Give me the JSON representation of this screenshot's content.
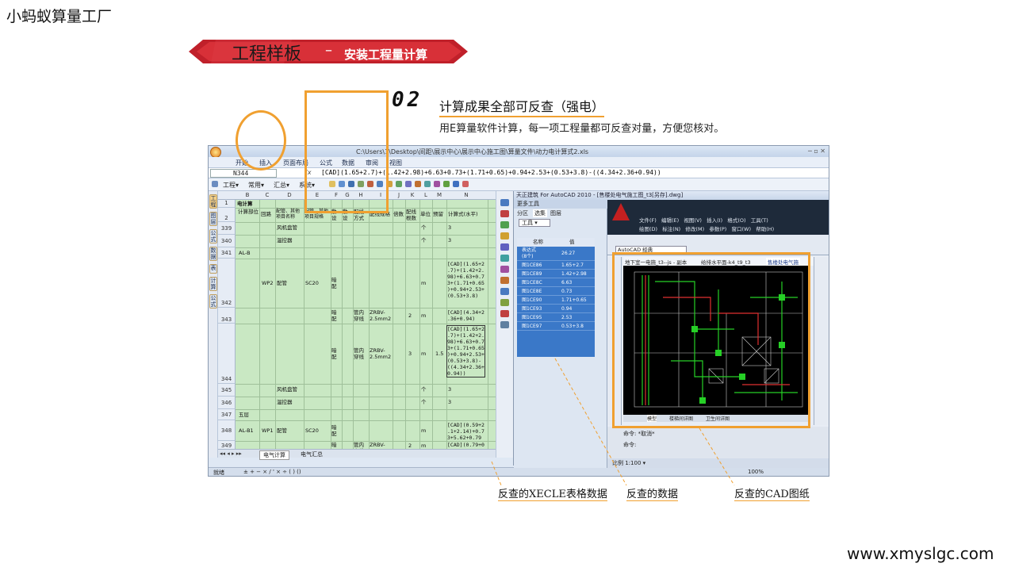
{
  "brand": "小蚂蚁算量工厂",
  "banner": {
    "title": "工程样板",
    "dash": "–",
    "subtitle": "安装工程量计算"
  },
  "section": {
    "number": "02",
    "title": "计算成果全部可反查（强电）",
    "description": "用E算量软件计算，每一项工程量都可反查对量，方便您核对。"
  },
  "website": "www.xmyslgc.com",
  "excel": {
    "window_title": "C:\\Users\\1\\Desktop\\间距\\展示中心\\展示中心施工图\\算量文件\\动力电计算式2.xls",
    "window_buttons": "─ ▫ ✕",
    "ribbon_tabs": [
      "开始",
      "插入",
      "页面布局",
      "公式",
      "数据",
      "审阅",
      "视图"
    ],
    "name_box": "N344",
    "fx": "fx",
    "formula": "[CAD](1.65+2.7)+(1.42+2.98)+6.63+0.73+(1.71+0.65)+0.94+2.53+(0.53+3.8)-((4.34+2.36+0.94))",
    "toolbar": [
      "工程▾",
      "常用▾",
      "汇总▾",
      "系统▾"
    ],
    "side_tabs": [
      "工程",
      "图层",
      "公式",
      "数据",
      "表",
      "计算",
      "公式"
    ],
    "columns": [
      "B",
      "C",
      "D",
      "E",
      "F",
      "G",
      "H",
      "I",
      "J",
      "K",
      "L",
      "M",
      "N"
    ],
    "header_row": {
      "row": "2",
      "cells": [
        "计算部位",
        "回路",
        "配管、其他项目名称",
        "配管、其他项目规格",
        "敷设",
        "敷设",
        "配线方式",
        "配线规格",
        "倍数",
        "配线根数",
        "单位",
        "预留",
        "计算式(水平)"
      ]
    },
    "title_row": {
      "row": "1",
      "text": "电计算"
    },
    "rows": [
      {
        "row": "339",
        "name": "风机盘管",
        "unit": "个",
        "value": "3"
      },
      {
        "row": "340",
        "name": "温控器",
        "unit": "个",
        "value": "3"
      },
      {
        "row": "341",
        "part": "AL-B"
      },
      {
        "row": "342",
        "circuit": "WP2",
        "name": "配管",
        "spec": "SC20",
        "lay": "暗配",
        "unit": "m",
        "formula": "[CAD](1.65+2\n.7)+(1.42+2.\n98)+6.63+0.7\n3+(1.71+0.65\n)+0.94+2.53+\n(0.53+3.8)"
      },
      {
        "row": "343",
        "lay": "暗配",
        "method": "管内穿线",
        "wire": "ZRBV-2.5mm2",
        "count": "2",
        "unit": "m",
        "formula": "[CAD](4.34+2\n.36+0.94)"
      },
      {
        "row": "344",
        "lay": "暗配",
        "method": "管内穿线",
        "wire": "ZRBV-2.5mm2",
        "count": "3",
        "unit": "m",
        "reserve": "1.5",
        "formula": "[CAD](1.65+2\n.7)+(1.42+2.\n98)+6.63+0.7\n3+(1.71+0.65\n)+0.94+2.53+\n(0.53+3.8)-\n((4.34+2.36+\n0.94))"
      },
      {
        "row": "345",
        "name": "风机盘管",
        "unit": "个",
        "value": "3"
      },
      {
        "row": "346",
        "name": "温控器",
        "unit": "个",
        "value": "3"
      },
      {
        "row": "347",
        "part": "五层"
      },
      {
        "row": "348",
        "part": "AL-B1",
        "circuit": "WP1",
        "name": "配管",
        "spec": "SC20",
        "lay": "暗配",
        "unit": "m",
        "formula": "[CAD](0.59+2\n.1+2.14)+0.7\n3+5.62+0.79"
      },
      {
        "row": "349",
        "lay": "暗配",
        "method": "管内穿线",
        "wire": "ZRBV-2.5mm2",
        "count": "2",
        "unit": "m",
        "formula": "[CAD](0.79+0\n.73)"
      }
    ],
    "sheet_tabs": [
      "电气计算",
      "电气汇总"
    ],
    "status_left": "就绪",
    "status_symbols": "± + − × / ' × ÷ ( ) ()",
    "zoom": "100%"
  },
  "cad": {
    "window_title": "天正建筑 For AutoCAD 2010 - [售楼处电气施工图_t3[另存].dwg]",
    "panel_title": "更多工具",
    "panel_tabs": [
      "分区",
      "选集",
      "图层"
    ],
    "tool_select": "工具 ▾",
    "table_header": {
      "name": "名称",
      "value": "值"
    },
    "table_rows": [
      {
        "name": "表达式\n(8个)",
        "value": "26.27"
      },
      {
        "name": "图1CE86",
        "value": "1.65+2.7"
      },
      {
        "name": "图1CE89",
        "value": "1.42+2.98"
      },
      {
        "name": "图1CE8C",
        "value": "6.63"
      },
      {
        "name": "图1CE8E",
        "value": "0.73"
      },
      {
        "name": "图1CE90",
        "value": "1.71+0.65"
      },
      {
        "name": "图1CE93",
        "value": "0.94"
      },
      {
        "name": "图1CE95",
        "value": "2.53"
      },
      {
        "name": "图1CE97",
        "value": "0.53+3.8"
      }
    ],
    "menu_row1": [
      "文件(F)",
      "编辑(E)",
      "视图(V)",
      "插入(I)",
      "格式(O)",
      "工具(T)"
    ],
    "menu_row2": [
      "绘图(D)",
      "标注(N)",
      "修改(M)",
      "参数(P)",
      "窗口(W)",
      "帮助(H)"
    ],
    "layer_select": "AutoCAD 经典",
    "drawing_tabs": [
      "地下室一电施_t3--js - 副本",
      "给排水平面-k4_t9_t3",
      "售楼处电气施"
    ],
    "layout_tabs": [
      "模型",
      "楼梯间详图",
      "卫生间详图"
    ],
    "command_lines": [
      "命令: *取消*",
      "命令:"
    ],
    "scale": "比例 1:100 ▾"
  },
  "callouts": [
    "反查的XECLE表格数据",
    "反查的数据",
    "反查的CAD图纸"
  ],
  "colors": {
    "highlight": "#f0a030",
    "banner_red": "#c0202a",
    "sheet_green": "#c9e8c3",
    "panel_blue": "#3a78c8"
  }
}
